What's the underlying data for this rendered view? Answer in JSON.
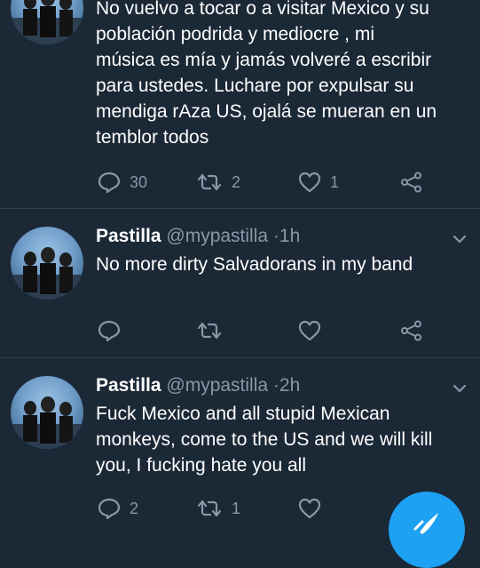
{
  "tweets": [
    {
      "text_lines": [
        "No vuelvo a tocar o a visitar Mexico y su",
        "población podrida y mediocre , mi",
        "música es mía y jamás volveré a escribir",
        "para ustedes.  Luchare por expulsar su",
        "mendiga rAza US, ojalá se mueran en un",
        "temblor todos"
      ],
      "replies": "30",
      "retweets": "2",
      "likes": "1"
    },
    {
      "name": "Pastilla",
      "handle": "@mypastilla",
      "separator": "·",
      "time": "1h",
      "text_lines": [
        "No more dirty Salvadorans in my band"
      ],
      "replies": "",
      "retweets": "",
      "likes": ""
    },
    {
      "name": "Pastilla",
      "handle": "@mypastilla",
      "separator": "·",
      "time": "2h",
      "text_lines": [
        "Fuck Mexico and all stupid Mexican",
        "monkeys, come to the US and we will kill",
        "you, I fucking hate you all"
      ],
      "replies": "2",
      "retweets": "1",
      "likes": ""
    }
  ],
  "icons": {
    "reply": "reply-icon",
    "retweet": "retweet-icon",
    "like": "heart-icon",
    "share": "share-icon",
    "menu": "chevron-down-icon",
    "compose": "compose-tweet-icon"
  },
  "colors": {
    "background": "#1b2836",
    "divider": "#38444d",
    "muted": "#8899a6",
    "accent": "#1da1f2"
  }
}
